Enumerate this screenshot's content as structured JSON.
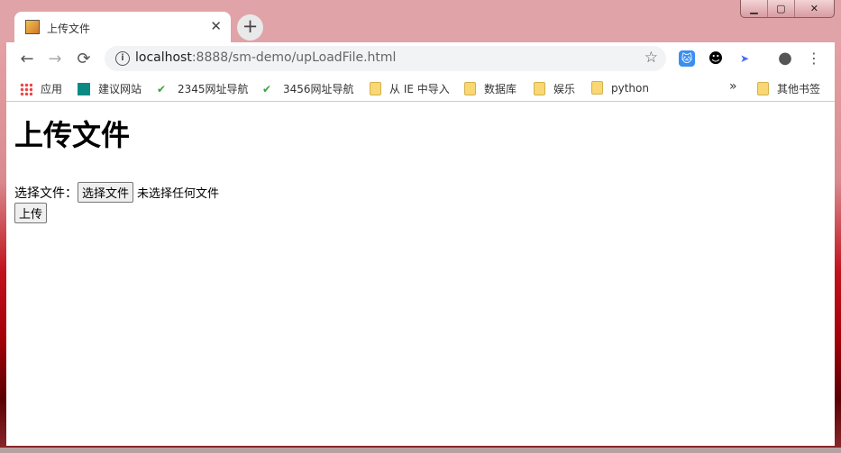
{
  "window": {
    "minimize": "▁",
    "maximize": "▢",
    "close": "✕"
  },
  "tab": {
    "title": "上传文件",
    "close": "✕",
    "new_tab": "+"
  },
  "nav": {
    "back": "←",
    "forward": "→",
    "reload": "⟳"
  },
  "omnibox": {
    "host": "localhost",
    "path": ":8888/sm-demo/upLoadFile.html",
    "info_icon": "i",
    "star": "☆"
  },
  "extensions": [
    {
      "name": "cat-extension-icon",
      "glyph": "🐱"
    },
    {
      "name": "face-extension-icon",
      "glyph": "☻"
    },
    {
      "name": "bird-extension-icon",
      "glyph": "➤"
    }
  ],
  "profile": "●",
  "menu": "⋮",
  "bookmarks": [
    {
      "label": "应用"
    },
    {
      "label": "建议网站"
    },
    {
      "label": "2345网址导航"
    },
    {
      "label": "3456网址导航"
    },
    {
      "label": "从 IE 中导入"
    },
    {
      "label": "数据库"
    },
    {
      "label": "娱乐"
    },
    {
      "label": "python"
    }
  ],
  "bookmarks_overflow": "»",
  "other_bookmarks": "其他书签",
  "page": {
    "heading": "上传文件",
    "file_label": "选择文件：",
    "file_button": "选择文件",
    "file_status": "未选择任何文件",
    "upload_button": "上传"
  }
}
